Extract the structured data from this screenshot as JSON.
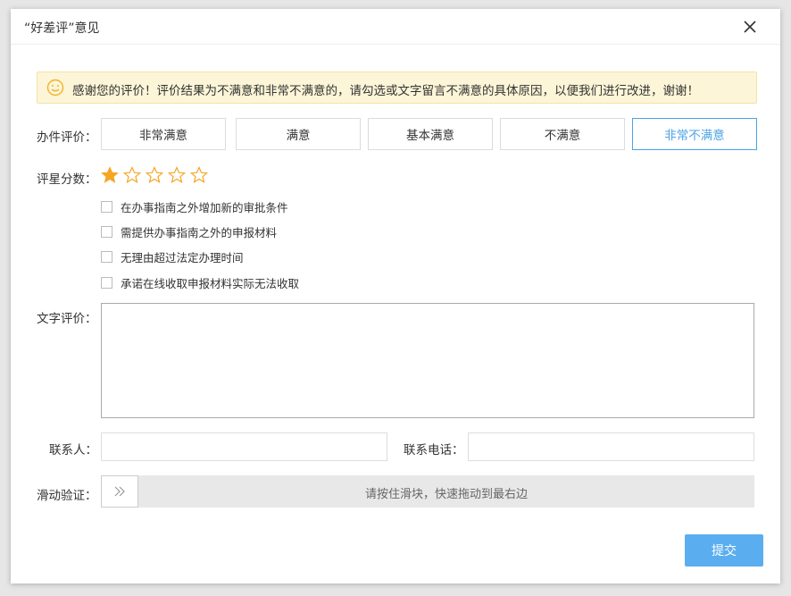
{
  "dialog": {
    "title": "“好差评”意见",
    "close_icon": "close-icon"
  },
  "notice": {
    "icon": "smile-icon",
    "text": "感谢您的评价！评价结果为不满意和非常不满意的，请勾选或文字留言不满意的具体原因，以便我们进行改进，谢谢！"
  },
  "evaluation": {
    "label": "办件评价：",
    "options": [
      "非常满意",
      "满意",
      "基本满意",
      "不满意",
      "非常不满意"
    ],
    "selected": "非常不满意"
  },
  "rating": {
    "label": "评星分数：",
    "max": 5,
    "value": 1,
    "color": "#f5a623"
  },
  "reasons": [
    {
      "label": "在办事指南之外增加新的审批条件",
      "checked": false
    },
    {
      "label": "需提供办事指南之外的申报材料",
      "checked": false
    },
    {
      "label": "无理由超过法定办理时间",
      "checked": false
    },
    {
      "label": "承诺在线收取申报材料实际无法收取",
      "checked": false
    }
  ],
  "comment": {
    "label": "文字评价：",
    "value": "",
    "placeholder": ""
  },
  "contact": {
    "name_label": "联系人：",
    "name_value": "",
    "phone_label": "联系电话：",
    "phone_value": ""
  },
  "slider": {
    "label": "滑动验证：",
    "hint": "请按住滑块，快速拖动到最右边",
    "icon": "double-chevron-right-icon"
  },
  "submit": {
    "label": "提交"
  },
  "colors": {
    "accent": "#4aa3e6",
    "submit_bg": "#5aaef0",
    "notice_bg": "#fdf5d7"
  }
}
